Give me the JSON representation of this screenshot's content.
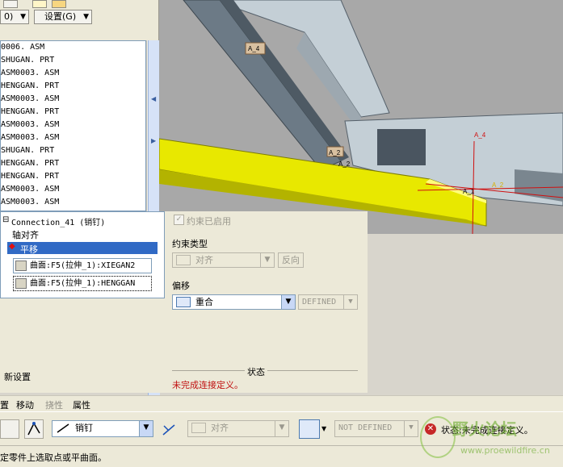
{
  "top_toolbar": {
    "view_menu_label": "0)",
    "settings_menu_label": "设置(G)"
  },
  "model_tree": {
    "items": [
      {
        "label": "0006. ASM"
      },
      {
        "label": "SHUGAN. PRT"
      },
      {
        "label": "ASM0003. ASM"
      },
      {
        "label": "HENGGAN. PRT"
      },
      {
        "label": "ASM0003. ASM"
      },
      {
        "label": "HENGGAN. PRT"
      },
      {
        "label": "ASM0003. ASM"
      },
      {
        "label": "ASM0003. ASM"
      },
      {
        "label": "SHUGAN. PRT"
      },
      {
        "label": "HENGGAN. PRT"
      },
      {
        "label": "HENGGAN. PRT"
      },
      {
        "label": "ASM0003. ASM"
      },
      {
        "label": "ASM0003. ASM"
      }
    ]
  },
  "viewport": {
    "labels": [
      "A_4",
      "A_2",
      "A_4",
      "A_2",
      "A_1",
      "A_2"
    ],
    "colors": {
      "yellow_part": "#e8e800",
      "grey_part": "#c4cfd6",
      "background": "#a8a8a8"
    }
  },
  "connection": {
    "title": "Connection_41 (销钉)",
    "items": [
      "轴对齐",
      "平移"
    ],
    "references": [
      "曲面:F5(拉伸_1):XIEGAN2",
      "曲面:F5(拉伸_1):HENGGAN"
    ],
    "new_set_label": "新设置"
  },
  "constraint": {
    "enabled_label": "约束已启用",
    "type_heading": "约束类型",
    "type_value": "对齐",
    "flip_label": "反向",
    "offset_heading": "偏移",
    "offset_value": "重合",
    "offset_field": "DEFINED",
    "status_heading": "状态",
    "status_text": "未完成连接定义。"
  },
  "tabs": [
    "置",
    "移动",
    "挠性",
    "属性"
  ],
  "bottom_toolbar": {
    "connection_type": "销钉",
    "constraint_value": "对齐",
    "offset_value": "NOT DEFINED",
    "status_text": "状态:未完成连接定义。"
  },
  "status_bar": {
    "message": "定零件上选取点或平曲面。"
  },
  "watermark": {
    "text": "野火论坛",
    "url": "www.proewildfire.cn"
  }
}
